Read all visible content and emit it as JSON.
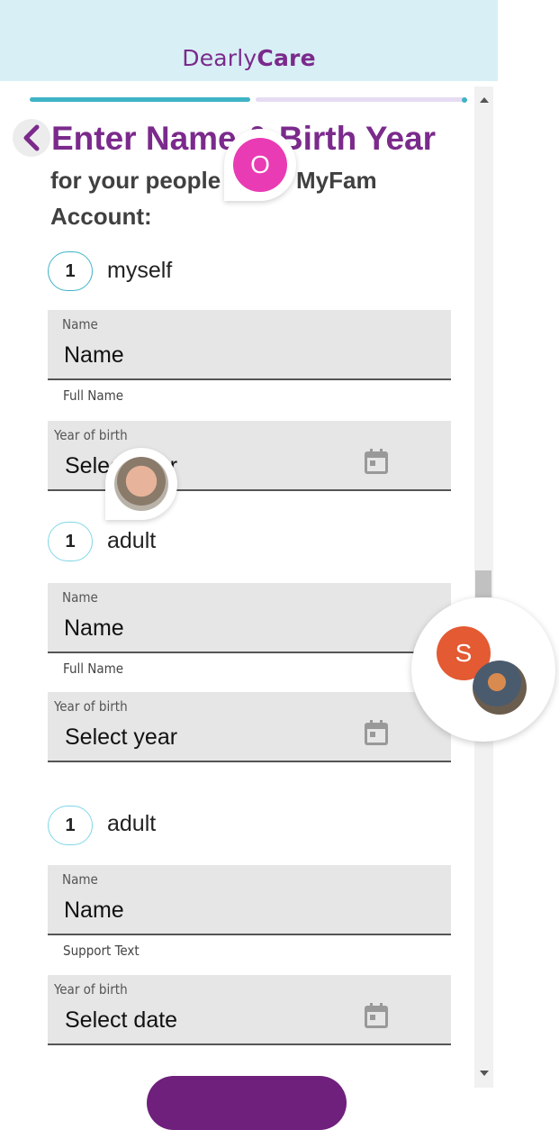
{
  "header": {
    "brand_light": "Dearly",
    "brand_bold": "Care"
  },
  "page": {
    "title": "Enter Name & Birth Year",
    "subtitle": "for your people in the MyFam Account:"
  },
  "members": [
    {
      "count": "1",
      "label": "myself",
      "name_field": {
        "label": "Name",
        "value": "Name",
        "support": "Full Name"
      },
      "year_field": {
        "label": "Year of birth",
        "value": "Select year"
      }
    },
    {
      "count": "1",
      "label": "adult",
      "name_field": {
        "label": "Name",
        "value": "Name",
        "support": "Full Name"
      },
      "year_field": {
        "label": "Year of birth",
        "value": "Select year"
      }
    },
    {
      "count": "1",
      "label": "adult",
      "name_field": {
        "label": "Name",
        "value": "Name",
        "support": "Support Text"
      },
      "year_field": {
        "label": "Year of birth",
        "value": "Select date"
      }
    }
  ],
  "avatars": {
    "o_initial": "O",
    "s_initial": "S"
  },
  "colors": {
    "brand_purple": "#7b2a8c",
    "accent_teal": "#3fb3c6",
    "field_bg": "#e6e6e6",
    "header_bg": "#d8f0f5"
  },
  "icons": [
    "chevron-left-icon",
    "calendar-icon"
  ]
}
